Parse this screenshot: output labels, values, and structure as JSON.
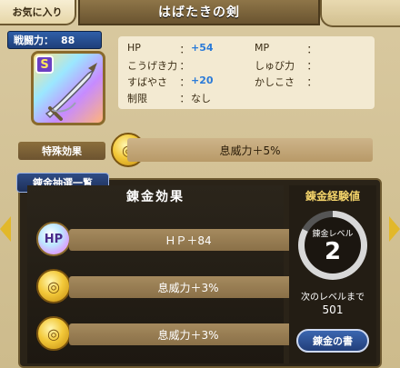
{
  "header": {
    "favorite_label": "お気に入り",
    "item_name": "はばたきの剣"
  },
  "power": {
    "label": "戦闘力：",
    "value": "88"
  },
  "weapon": {
    "rank": "S",
    "icon": "sword-icon"
  },
  "stats": {
    "hp_label": "HP",
    "hp_value": "+54",
    "mp_label": "MP",
    "mp_value": "",
    "atk_label": "こうげき力",
    "atk_value": "",
    "def_label": "しゅび力",
    "def_value": "",
    "spd_label": "すばやさ",
    "spd_value": "+20",
    "int_label": "かしこさ",
    "int_value": "",
    "limit_label": "制限",
    "limit_value": "なし",
    "separator": "："
  },
  "special": {
    "label": "特殊効果",
    "text": "息威力＋5%"
  },
  "alchemy": {
    "list_tab": "錬金抽選一覧",
    "title": "錬金効果",
    "effects": [
      {
        "badge": "HP",
        "text": "ＨＰ＋84"
      },
      {
        "badge": "",
        "text": "息威力＋3%"
      },
      {
        "badge": "",
        "text": "息威力＋3%"
      }
    ]
  },
  "experience": {
    "title": "錬金経験値",
    "level_label": "錬金レベル",
    "level": "2",
    "level_progress": 0.83,
    "next_label": "次のレベルまで",
    "next_value": "501",
    "book_button": "錬金の書"
  },
  "colors": {
    "accent": "#e2b82a",
    "blue_value": "#2b7bd8",
    "badge_blue": "#2f5fa8"
  }
}
